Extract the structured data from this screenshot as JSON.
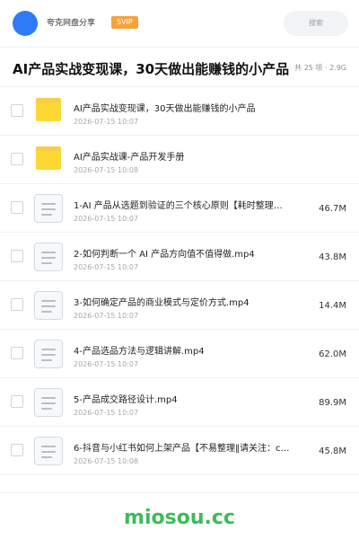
{
  "header": {
    "brand": "夸克网盘分享",
    "badge": "SVIP",
    "search_placeholder": "搜索"
  },
  "share": {
    "title": "AI产品实战变现课，30天做出能赚钱的小产品",
    "meta": "共 25 项 · 2.9G"
  },
  "files": [
    {
      "type": "folder",
      "name": "AI产品实战变现课，30天做出能赚钱的小产品",
      "date": "2026-07-15 10:07",
      "size": ""
    },
    {
      "type": "folder",
      "name": "AI产品实战课-产品开发手册",
      "date": "2026-07-15 10:08",
      "size": ""
    },
    {
      "type": "file",
      "name": "1-AI 产品从选题到验证的三个核心原则【耗时整理…",
      "date": "2026-07-15 10:07",
      "size": "46.7M"
    },
    {
      "type": "file",
      "name": "2-如何判断一个 AI 产品方向值不值得做.mp4",
      "date": "2026-07-15 10:07",
      "size": "43.8M"
    },
    {
      "type": "file",
      "name": "3-如何确定产品的商业模式与定价方式.mp4",
      "date": "2026-07-15 10:07",
      "size": "14.4M"
    },
    {
      "type": "file",
      "name": "4-产品选品方法与逻辑讲解.mp4",
      "date": "2026-07-15 10:07",
      "size": "62.0M"
    },
    {
      "type": "file",
      "name": "5-产品成交路径设计.mp4",
      "date": "2026-07-15 10:07",
      "size": "89.9M"
    },
    {
      "type": "file",
      "name": "6-抖音与小红书如何上架产品【不易整理‖请关注：c…",
      "date": "2026-07-15 10:08",
      "size": "45.8M"
    }
  ],
  "watermark": "miosou.cc",
  "colors": {
    "accent": "#2f7bf5",
    "svip": "#f6a23c",
    "folder": "#fdd835",
    "watermark": "#3cbc59"
  },
  "icons": {
    "folder": "folder-icon",
    "file": "document-icon"
  }
}
